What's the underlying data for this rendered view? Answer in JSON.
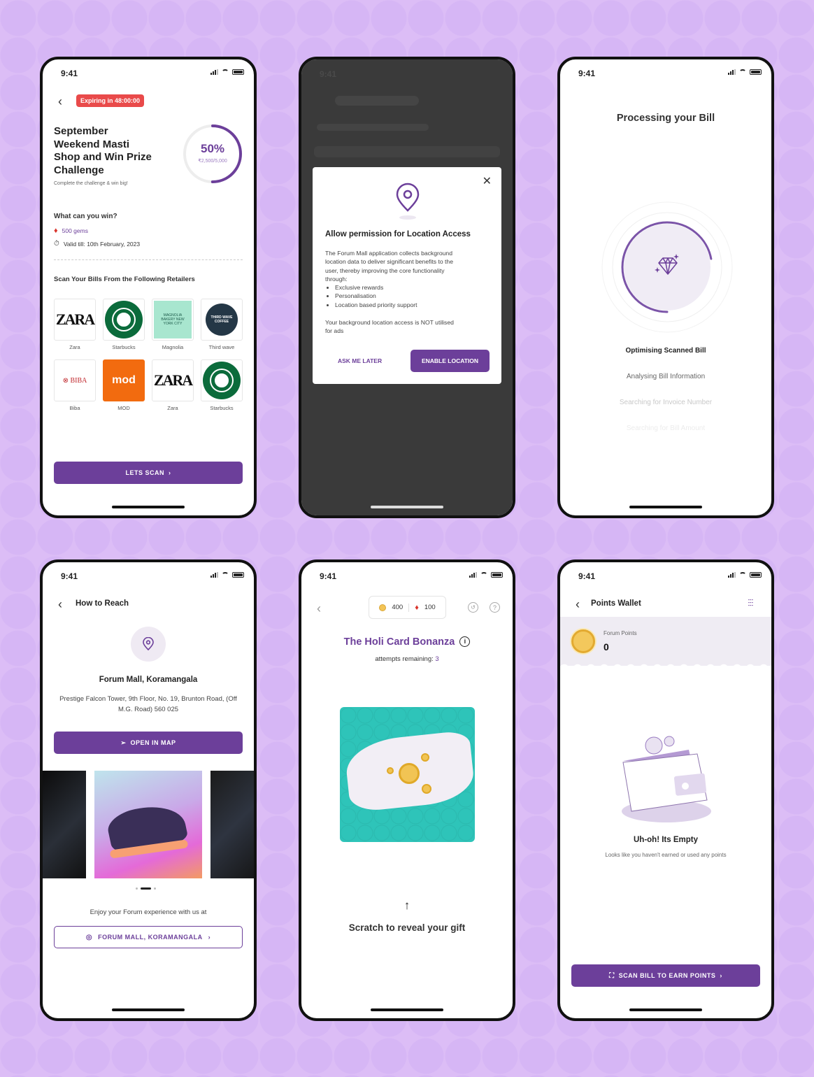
{
  "status_time": "9:41",
  "challenge": {
    "expiry_badge": "Expiring in 48:00:00",
    "title_lines": [
      "September",
      "Weekend Masti",
      "Shop and Win Prize",
      "Challenge"
    ],
    "subtitle": "Complete the challenge & win big!",
    "progress_percent_label": "50%",
    "progress_fraction": 0.5,
    "progress_amount": "₹2,500/5,000",
    "win_heading": "What can you win?",
    "prize": "500 gems",
    "validity": "Valid till: 10th February, 2023",
    "retailers_heading": "Scan Your Bills From the Following Retailers",
    "retailers": [
      {
        "name": "Zara",
        "logo_text": "ZARA"
      },
      {
        "name": "Starbucks",
        "logo_text": ""
      },
      {
        "name": "Magnolia",
        "logo_text": "MAGNOLIA BAKERY NEW YORK CITY"
      },
      {
        "name": "Third wave",
        "logo_text": "THIRD WAVE COFFEE"
      },
      {
        "name": "Biba",
        "logo_text": "⊗ BIBA"
      },
      {
        "name": "MOD",
        "logo_text": "mod"
      },
      {
        "name": "Zara",
        "logo_text": "ZARA"
      },
      {
        "name": "Starbucks",
        "logo_text": ""
      }
    ],
    "cta": "LETS SCAN"
  },
  "location_dialog": {
    "title": "Allow permission for Location Access",
    "body": "The Forum Mall application collects background location data to deliver significant benefits to the user, thereby improving the core functionality through:",
    "bullets": [
      "Exclusive rewards",
      "Personalisation",
      "Location based priority support"
    ],
    "note": "Your background location access is NOT utilised for ads",
    "secondary": "ASK ME LATER",
    "primary": "ENABLE LOCATION"
  },
  "processing": {
    "title": "Processing your Bill",
    "steps": [
      "Optimising Scanned Bill",
      "Analysing Bill Information",
      "Searching for Invoice Number",
      "Searching for Bill Amount"
    ],
    "progress_fraction": 0.72
  },
  "reach": {
    "title": "How to Reach",
    "mall": "Forum Mall, Koramangala",
    "address": "Prestige Falcon Tower, 9th Floor, No. 19, Brunton Road, (Off M.G. Road) 560 025",
    "map_btn": "OPEN IN MAP",
    "carousel_active": 2,
    "carousel_count": 3,
    "enjoy": "Enjoy your Forum experience with us at",
    "mall_btn": "FORUM MALL, KORAMANGALA"
  },
  "scratch": {
    "coins": "400",
    "gems": "100",
    "title": "The Holi Card Bonanza",
    "attempts_label": "attempts remaining:",
    "attempts": "3",
    "arrow": "↑",
    "hint": "Scratch to reveal your gift"
  },
  "wallet": {
    "title": "Points Wallet",
    "points_label": "Forum Points",
    "points": "0",
    "empty_title": "Uh-oh! Its Empty",
    "empty_sub": "Looks like you haven't earned or used any points",
    "cta": "SCAN BILL TO EARN POINTS"
  },
  "colors": {
    "brand": "#6c3f9a",
    "expiry": "#e94a4a",
    "scratch_bg": "#2ec4b9"
  }
}
